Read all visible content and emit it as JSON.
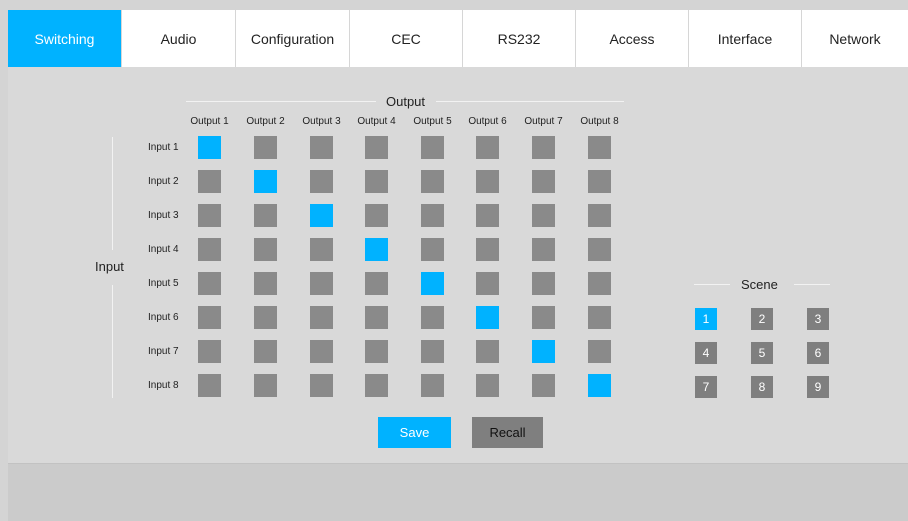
{
  "tabs": [
    {
      "label": "Switching",
      "active": true
    },
    {
      "label": "Audio",
      "active": false
    },
    {
      "label": "Configuration",
      "active": false
    },
    {
      "label": "CEC",
      "active": false
    },
    {
      "label": "RS232",
      "active": false
    },
    {
      "label": "Access",
      "active": false
    },
    {
      "label": "Interface",
      "active": false
    },
    {
      "label": "Network",
      "active": false
    }
  ],
  "matrix": {
    "output_title": "Output",
    "input_title": "Input",
    "outputs": [
      "Output 1",
      "Output 2",
      "Output 3",
      "Output 4",
      "Output 5",
      "Output 6",
      "Output 7",
      "Output 8"
    ],
    "inputs": [
      "Input 1",
      "Input 2",
      "Input 3",
      "Input 4",
      "Input 5",
      "Input 6",
      "Input 7",
      "Input 8"
    ],
    "active_output_for_input": [
      1,
      2,
      3,
      4,
      5,
      6,
      7,
      8
    ]
  },
  "scene": {
    "title": "Scene",
    "buttons": [
      "1",
      "2",
      "3",
      "4",
      "5",
      "6",
      "7",
      "8",
      "9"
    ],
    "selected": "1"
  },
  "actions": {
    "save": "Save",
    "recall": "Recall"
  },
  "colors": {
    "accent": "#00b2ff",
    "cell_off": "#8a8a8a",
    "scene_off": "#7f7f7f",
    "recall_bg": "#7f7f7f"
  }
}
